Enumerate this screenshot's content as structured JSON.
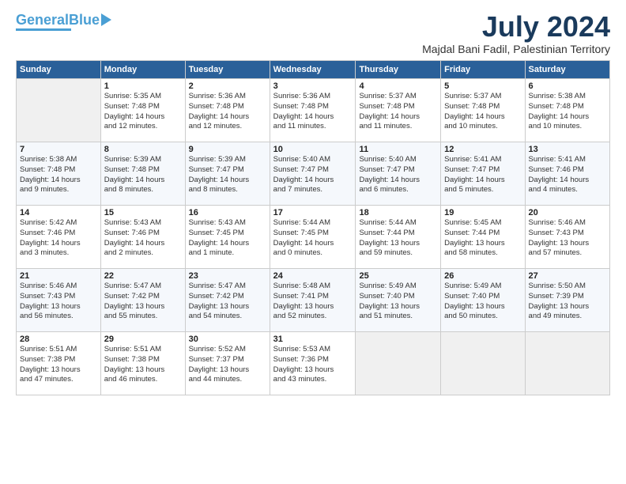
{
  "header": {
    "logo_general": "General",
    "logo_blue": "Blue",
    "month_title": "July 2024",
    "location": "Majdal Bani Fadil, Palestinian Territory"
  },
  "columns": [
    "Sunday",
    "Monday",
    "Tuesday",
    "Wednesday",
    "Thursday",
    "Friday",
    "Saturday"
  ],
  "weeks": [
    [
      {
        "day": "",
        "info": ""
      },
      {
        "day": "1",
        "info": "Sunrise: 5:35 AM\nSunset: 7:48 PM\nDaylight: 14 hours\nand 12 minutes."
      },
      {
        "day": "2",
        "info": "Sunrise: 5:36 AM\nSunset: 7:48 PM\nDaylight: 14 hours\nand 12 minutes."
      },
      {
        "day": "3",
        "info": "Sunrise: 5:36 AM\nSunset: 7:48 PM\nDaylight: 14 hours\nand 11 minutes."
      },
      {
        "day": "4",
        "info": "Sunrise: 5:37 AM\nSunset: 7:48 PM\nDaylight: 14 hours\nand 11 minutes."
      },
      {
        "day": "5",
        "info": "Sunrise: 5:37 AM\nSunset: 7:48 PM\nDaylight: 14 hours\nand 10 minutes."
      },
      {
        "day": "6",
        "info": "Sunrise: 5:38 AM\nSunset: 7:48 PM\nDaylight: 14 hours\nand 10 minutes."
      }
    ],
    [
      {
        "day": "7",
        "info": "Sunrise: 5:38 AM\nSunset: 7:48 PM\nDaylight: 14 hours\nand 9 minutes."
      },
      {
        "day": "8",
        "info": "Sunrise: 5:39 AM\nSunset: 7:48 PM\nDaylight: 14 hours\nand 8 minutes."
      },
      {
        "day": "9",
        "info": "Sunrise: 5:39 AM\nSunset: 7:47 PM\nDaylight: 14 hours\nand 8 minutes."
      },
      {
        "day": "10",
        "info": "Sunrise: 5:40 AM\nSunset: 7:47 PM\nDaylight: 14 hours\nand 7 minutes."
      },
      {
        "day": "11",
        "info": "Sunrise: 5:40 AM\nSunset: 7:47 PM\nDaylight: 14 hours\nand 6 minutes."
      },
      {
        "day": "12",
        "info": "Sunrise: 5:41 AM\nSunset: 7:47 PM\nDaylight: 14 hours\nand 5 minutes."
      },
      {
        "day": "13",
        "info": "Sunrise: 5:41 AM\nSunset: 7:46 PM\nDaylight: 14 hours\nand 4 minutes."
      }
    ],
    [
      {
        "day": "14",
        "info": "Sunrise: 5:42 AM\nSunset: 7:46 PM\nDaylight: 14 hours\nand 3 minutes."
      },
      {
        "day": "15",
        "info": "Sunrise: 5:43 AM\nSunset: 7:46 PM\nDaylight: 14 hours\nand 2 minutes."
      },
      {
        "day": "16",
        "info": "Sunrise: 5:43 AM\nSunset: 7:45 PM\nDaylight: 14 hours\nand 1 minute."
      },
      {
        "day": "17",
        "info": "Sunrise: 5:44 AM\nSunset: 7:45 PM\nDaylight: 14 hours\nand 0 minutes."
      },
      {
        "day": "18",
        "info": "Sunrise: 5:44 AM\nSunset: 7:44 PM\nDaylight: 13 hours\nand 59 minutes."
      },
      {
        "day": "19",
        "info": "Sunrise: 5:45 AM\nSunset: 7:44 PM\nDaylight: 13 hours\nand 58 minutes."
      },
      {
        "day": "20",
        "info": "Sunrise: 5:46 AM\nSunset: 7:43 PM\nDaylight: 13 hours\nand 57 minutes."
      }
    ],
    [
      {
        "day": "21",
        "info": "Sunrise: 5:46 AM\nSunset: 7:43 PM\nDaylight: 13 hours\nand 56 minutes."
      },
      {
        "day": "22",
        "info": "Sunrise: 5:47 AM\nSunset: 7:42 PM\nDaylight: 13 hours\nand 55 minutes."
      },
      {
        "day": "23",
        "info": "Sunrise: 5:47 AM\nSunset: 7:42 PM\nDaylight: 13 hours\nand 54 minutes."
      },
      {
        "day": "24",
        "info": "Sunrise: 5:48 AM\nSunset: 7:41 PM\nDaylight: 13 hours\nand 52 minutes."
      },
      {
        "day": "25",
        "info": "Sunrise: 5:49 AM\nSunset: 7:40 PM\nDaylight: 13 hours\nand 51 minutes."
      },
      {
        "day": "26",
        "info": "Sunrise: 5:49 AM\nSunset: 7:40 PM\nDaylight: 13 hours\nand 50 minutes."
      },
      {
        "day": "27",
        "info": "Sunrise: 5:50 AM\nSunset: 7:39 PM\nDaylight: 13 hours\nand 49 minutes."
      }
    ],
    [
      {
        "day": "28",
        "info": "Sunrise: 5:51 AM\nSunset: 7:38 PM\nDaylight: 13 hours\nand 47 minutes."
      },
      {
        "day": "29",
        "info": "Sunrise: 5:51 AM\nSunset: 7:38 PM\nDaylight: 13 hours\nand 46 minutes."
      },
      {
        "day": "30",
        "info": "Sunrise: 5:52 AM\nSunset: 7:37 PM\nDaylight: 13 hours\nand 44 minutes."
      },
      {
        "day": "31",
        "info": "Sunrise: 5:53 AM\nSunset: 7:36 PM\nDaylight: 13 hours\nand 43 minutes."
      },
      {
        "day": "",
        "info": ""
      },
      {
        "day": "",
        "info": ""
      },
      {
        "day": "",
        "info": ""
      }
    ]
  ]
}
